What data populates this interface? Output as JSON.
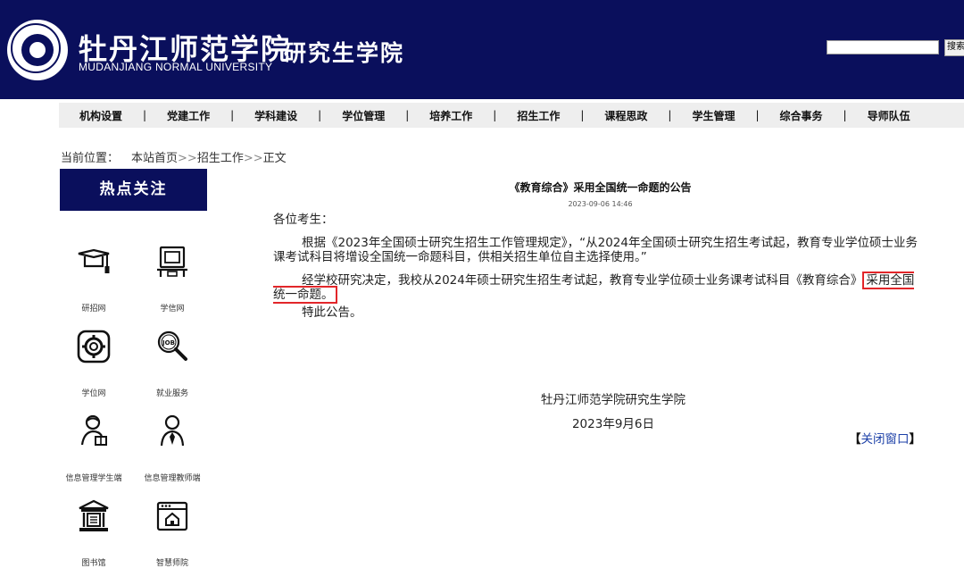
{
  "header": {
    "title_cn": "牡丹江师范学院",
    "subtitle_cn": "研究生学院",
    "title_en": "MUDANJIANG NORMAL UNIVERSITY",
    "search_button": "搜索",
    "bg_color": "#0a0f5c"
  },
  "nav": {
    "items": [
      "机构设置",
      "党建工作",
      "学科建设",
      "学位管理",
      "培养工作",
      "招生工作",
      "课程思政",
      "学生管理",
      "综合事务",
      "导师队伍"
    ],
    "separator": "|"
  },
  "breadcrumb": {
    "label": "当前位置：",
    "items": [
      "本站首页",
      "招生工作",
      "正文"
    ],
    "separator": ">>"
  },
  "sidebar": {
    "title": "热点关注",
    "links": [
      {
        "label": "研招网",
        "icon": "graduation-cap-icon"
      },
      {
        "label": "学信网",
        "icon": "computer-desk-icon"
      },
      {
        "label": "学位网",
        "icon": "gear-badge-icon"
      },
      {
        "label": "就业服务",
        "icon": "job-search-icon"
      },
      {
        "label": "信息管理学生端",
        "icon": "student-reading-icon"
      },
      {
        "label": "信息管理教师端",
        "icon": "teacher-icon"
      },
      {
        "label": "图书馆",
        "icon": "library-building-icon"
      },
      {
        "label": "智慧师院",
        "icon": "smart-home-window-icon"
      }
    ]
  },
  "article": {
    "title": "《教育综合》采用全国统一命题的公告",
    "datetime": "2023-09-06 14:46",
    "greeting": "各位考生：",
    "para1": "根据《2023年全国硕士研究生招生工作管理规定》，“从2024年全国硕士研究生招生考试起，教育专业学位硕士业务课考试科目将增设全国统一命题科目，供相关招生单位自主选择使用。”",
    "para2_before": "经学校研究决定，我校从2024年硕士研究生招生考试起，教育专业学位硕士业务课考试科目《教育综合》",
    "para2_highlight": "采用全国统一命题。",
    "para3": "特此公告。",
    "sign_org": "牡丹江师范学院研究生学院",
    "sign_date": "2023年9月6日",
    "close_left": "【",
    "close_text": "关闭窗口",
    "close_right": "】",
    "highlight_color": "#e2262a"
  }
}
